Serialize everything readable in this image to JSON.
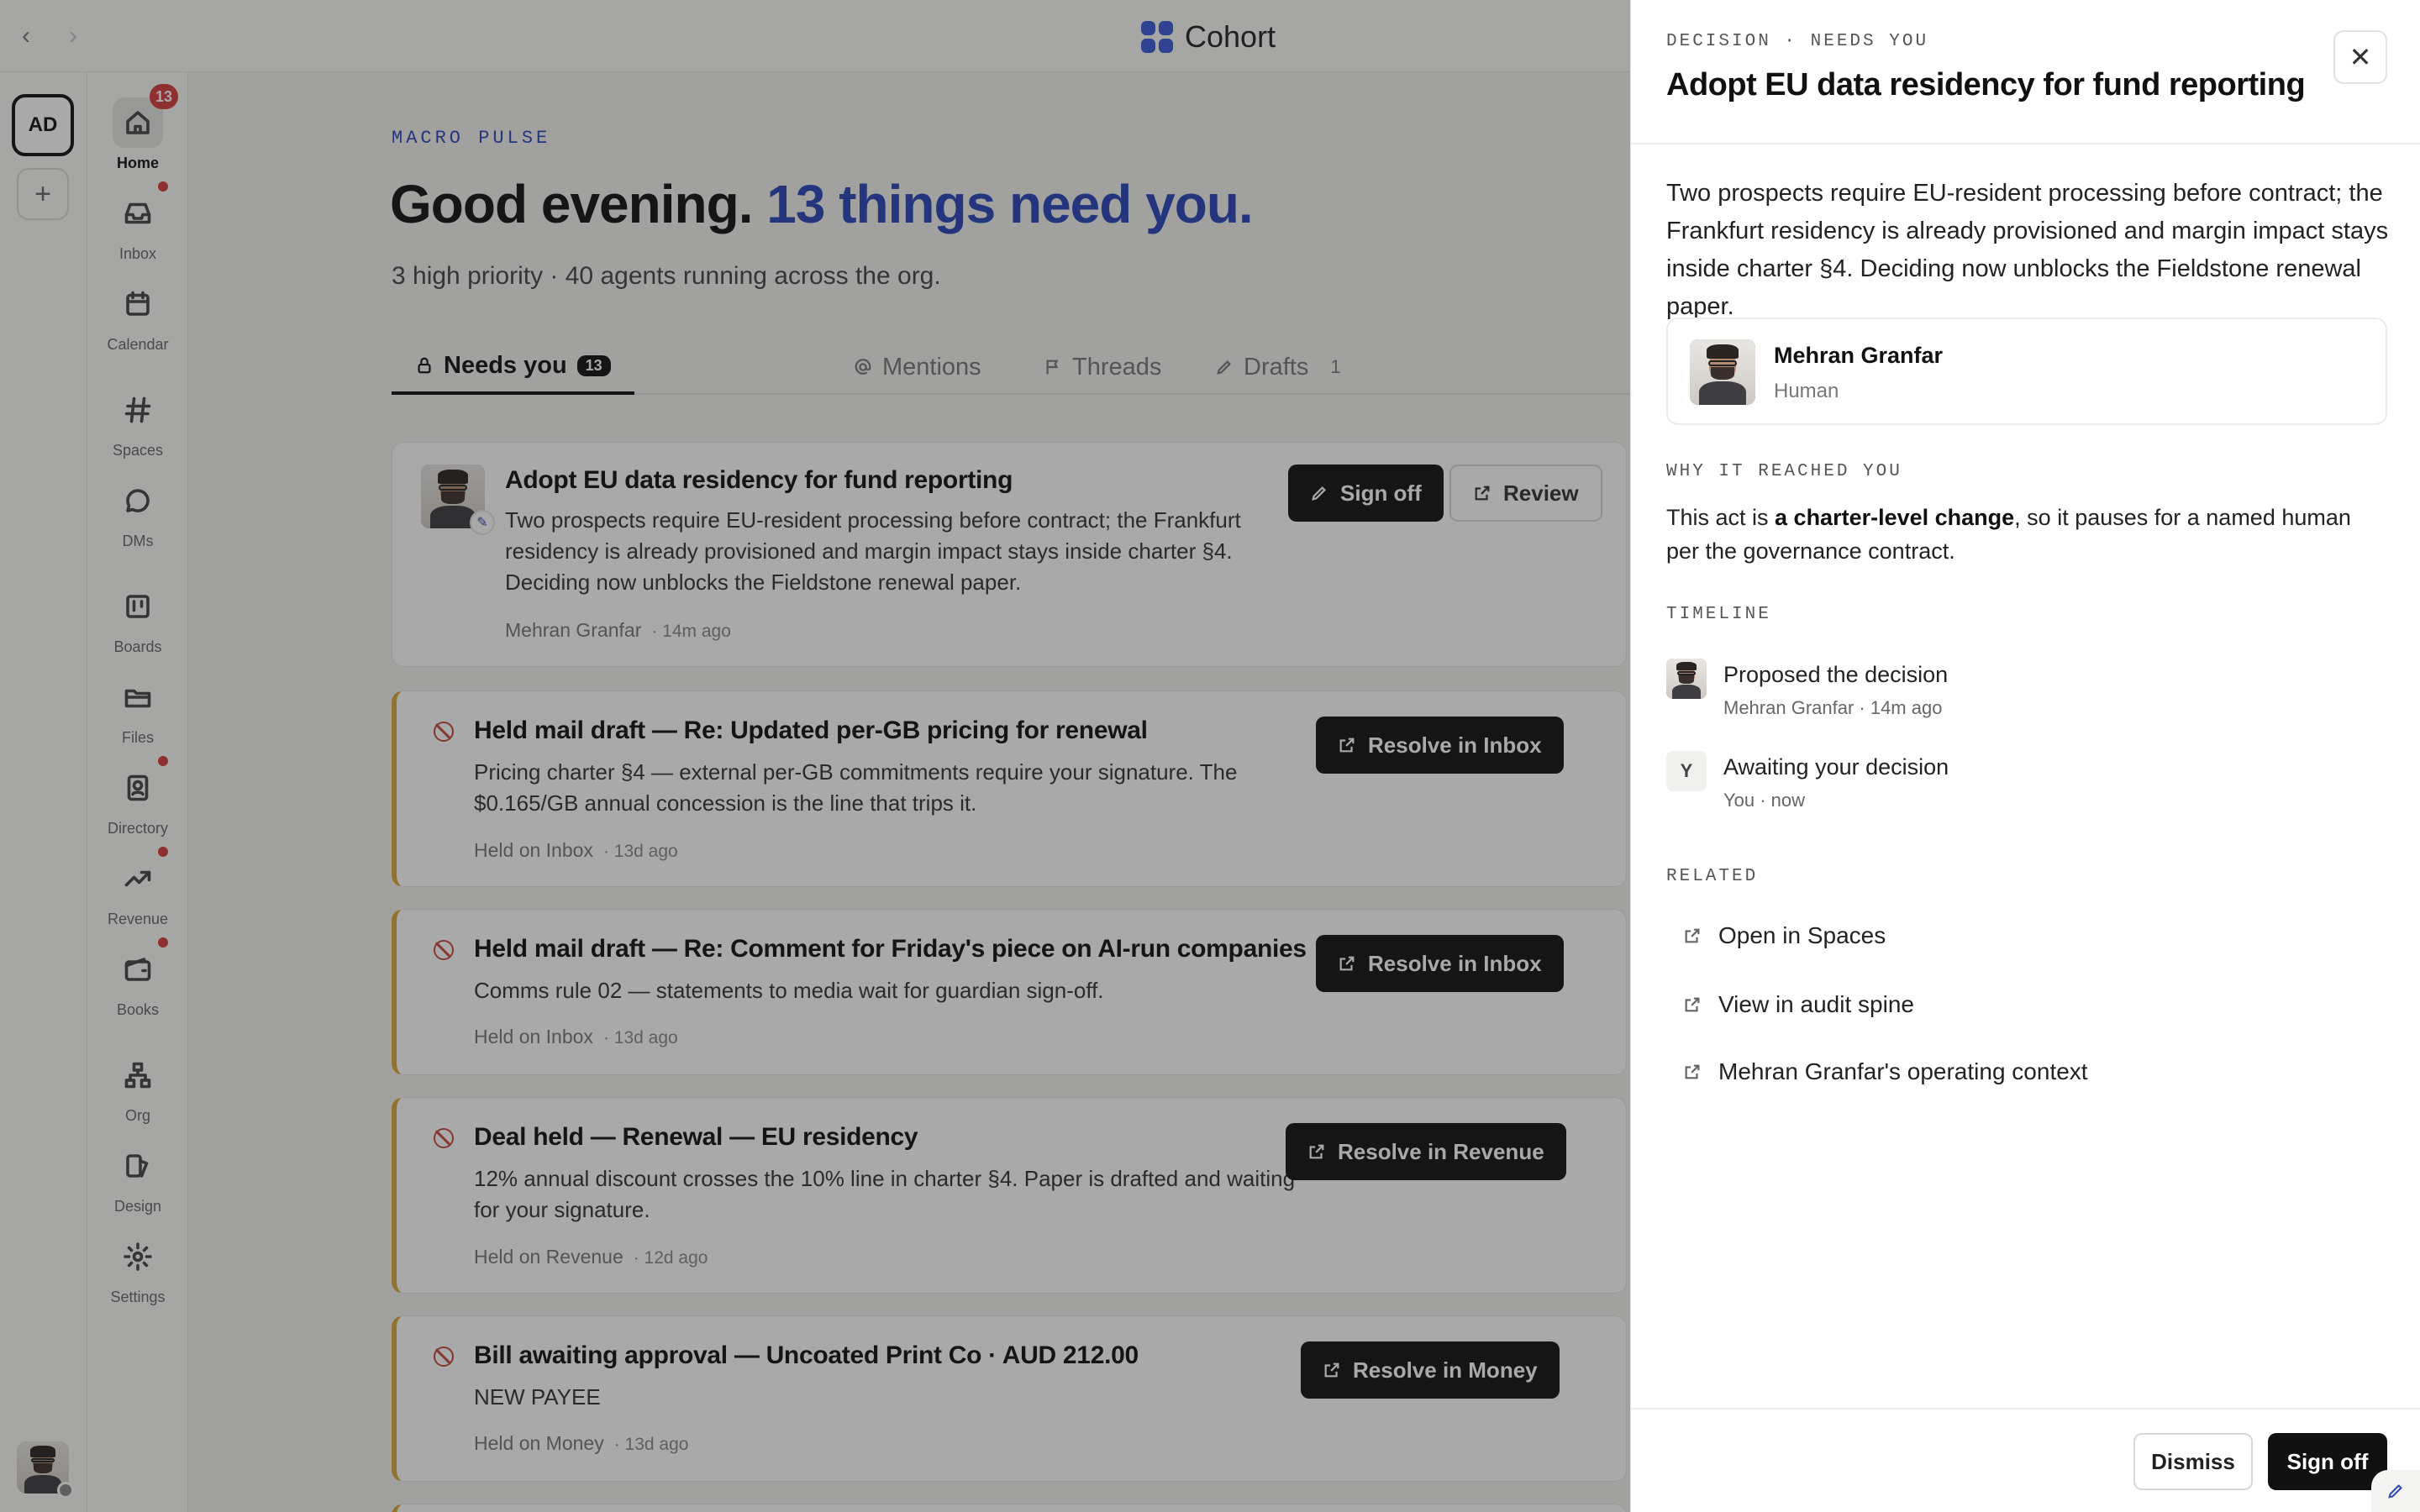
{
  "app": {
    "name": "Cohort",
    "brand_color": "#3a5bd9",
    "accent_color": "#2b45b8"
  },
  "rail": {
    "workspace_initials": "AD",
    "add_label": "+"
  },
  "sidebar": {
    "items": [
      {
        "label": "Home",
        "icon": "home-icon",
        "count": "13",
        "active": true
      },
      {
        "label": "Inbox",
        "icon": "inbox-icon",
        "dot": true
      },
      {
        "label": "Calendar",
        "icon": "calendar-icon"
      },
      {
        "label": "Spaces",
        "icon": "hash-icon"
      },
      {
        "label": "DMs",
        "icon": "chat-bubble-icon"
      },
      {
        "label": "Boards",
        "icon": "board-icon"
      },
      {
        "label": "Files",
        "icon": "folder-icon"
      },
      {
        "label": "Directory",
        "icon": "contact-card-icon",
        "dot": true
      },
      {
        "label": "Revenue",
        "icon": "trend-up-icon",
        "dot": true
      },
      {
        "label": "Books",
        "icon": "wallet-icon"
      },
      {
        "label": "Org",
        "icon": "org-chart-icon"
      },
      {
        "label": "Design",
        "icon": "design-icon"
      },
      {
        "label": "Settings",
        "icon": "gear-icon"
      }
    ]
  },
  "main": {
    "eyebrow": "MACRO PULSE",
    "greeting_plain": "Good evening. ",
    "greeting_accent": "13 things need you.",
    "subline": "3 high priority · 40 agents running across the org.",
    "tabs": [
      {
        "label": "Needs you",
        "count": "13",
        "icon": "lock-icon",
        "active": true
      },
      {
        "label": "Mentions",
        "icon": "at-icon"
      },
      {
        "label": "Threads",
        "icon": "flag-icon"
      },
      {
        "label": "Drafts",
        "count": "1",
        "icon": "pencil-icon"
      }
    ],
    "cards": [
      {
        "title": "Adopt EU data residency for fund reporting",
        "desc": "Two prospects require EU-resident processing before contract; the Frankfurt residency is already provisioned and margin impact stays inside charter §4. Deciding now unblocks the Fieldstone renewal paper.",
        "meta": "Mehran Granfar",
        "time": "· 14m ago",
        "primary": "Sign off",
        "secondary": "Review"
      },
      {
        "title": "Held mail draft — Re: Updated per-GB pricing for renewal",
        "desc": "Pricing charter §4 — external per-GB commitments require your signature. The $0.165/GB annual concession is the line that trips it.",
        "meta": "Held on Inbox",
        "time": "· 13d ago",
        "primary": "Resolve in Inbox"
      },
      {
        "title": "Held mail draft — Re: Comment for Friday's piece on AI-run companies",
        "desc": "Comms rule 02 — statements to media wait for guardian sign-off.",
        "meta": "Held on Inbox",
        "time": "· 13d ago",
        "primary": "Resolve in Inbox"
      },
      {
        "title": "Deal held — Renewal — EU residency",
        "desc": "12% annual discount crosses the 10% line in charter §4. Paper is drafted and waiting for your signature.",
        "meta": "Held on Revenue",
        "time": "· 12d ago",
        "primary": "Resolve in Revenue"
      },
      {
        "title": "Bill awaiting approval — Uncoated Print Co · AUD 212.00",
        "desc": "NEW PAYEE",
        "meta": "Held on Money",
        "time": "· 13d ago",
        "primary": "Resolve in Money"
      }
    ]
  },
  "panel": {
    "eyebrow": "DECISION · NEEDS YOU",
    "title": "Adopt EU data residency for fund reporting",
    "summary": "Two prospects require EU-resident processing before contract; the Frankfurt residency is already provisioned and margin impact stays inside charter §4. Deciding now unblocks the Fieldstone renewal paper.",
    "person": {
      "name": "Mehran Granfar",
      "role": "Human"
    },
    "why_heading": "WHY IT REACHED YOU",
    "why_pre": "This act is ",
    "why_bold": "a charter-level change",
    "why_post": ", so it pauses for a named human per the governance contract.",
    "timeline_heading": "TIMELINE",
    "timeline": [
      {
        "main": "Proposed the decision",
        "sub": "Mehran Granfar · 14m ago"
      },
      {
        "letter": "Y",
        "main": "Awaiting your decision",
        "sub": "You · now"
      }
    ],
    "related_heading": "RELATED",
    "related": [
      {
        "label": "Open in Spaces"
      },
      {
        "label": "View in audit spine"
      },
      {
        "label": "Mehran Granfar's operating context"
      }
    ],
    "dismiss": "Dismiss",
    "signoff": "Sign off"
  }
}
